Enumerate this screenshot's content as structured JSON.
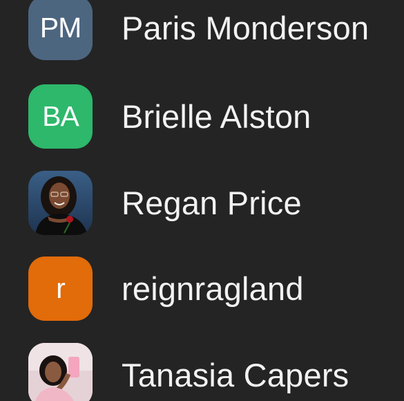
{
  "contacts": [
    {
      "name": "Paris Monderson",
      "avatar_type": "initials",
      "initials": "PM",
      "avatar_color": "#4d6680"
    },
    {
      "name": "Brielle Alston",
      "avatar_type": "initials",
      "initials": "BA",
      "avatar_color": "#2db86b"
    },
    {
      "name": "Regan Price",
      "avatar_type": "photo",
      "avatar_icon": "profile-photo-icon"
    },
    {
      "name": "reignragland",
      "avatar_type": "initials",
      "initials": "r",
      "avatar_color": "#e26b0a"
    },
    {
      "name": "Tanasia Capers",
      "avatar_type": "photo",
      "avatar_icon": "profile-photo-icon"
    }
  ]
}
